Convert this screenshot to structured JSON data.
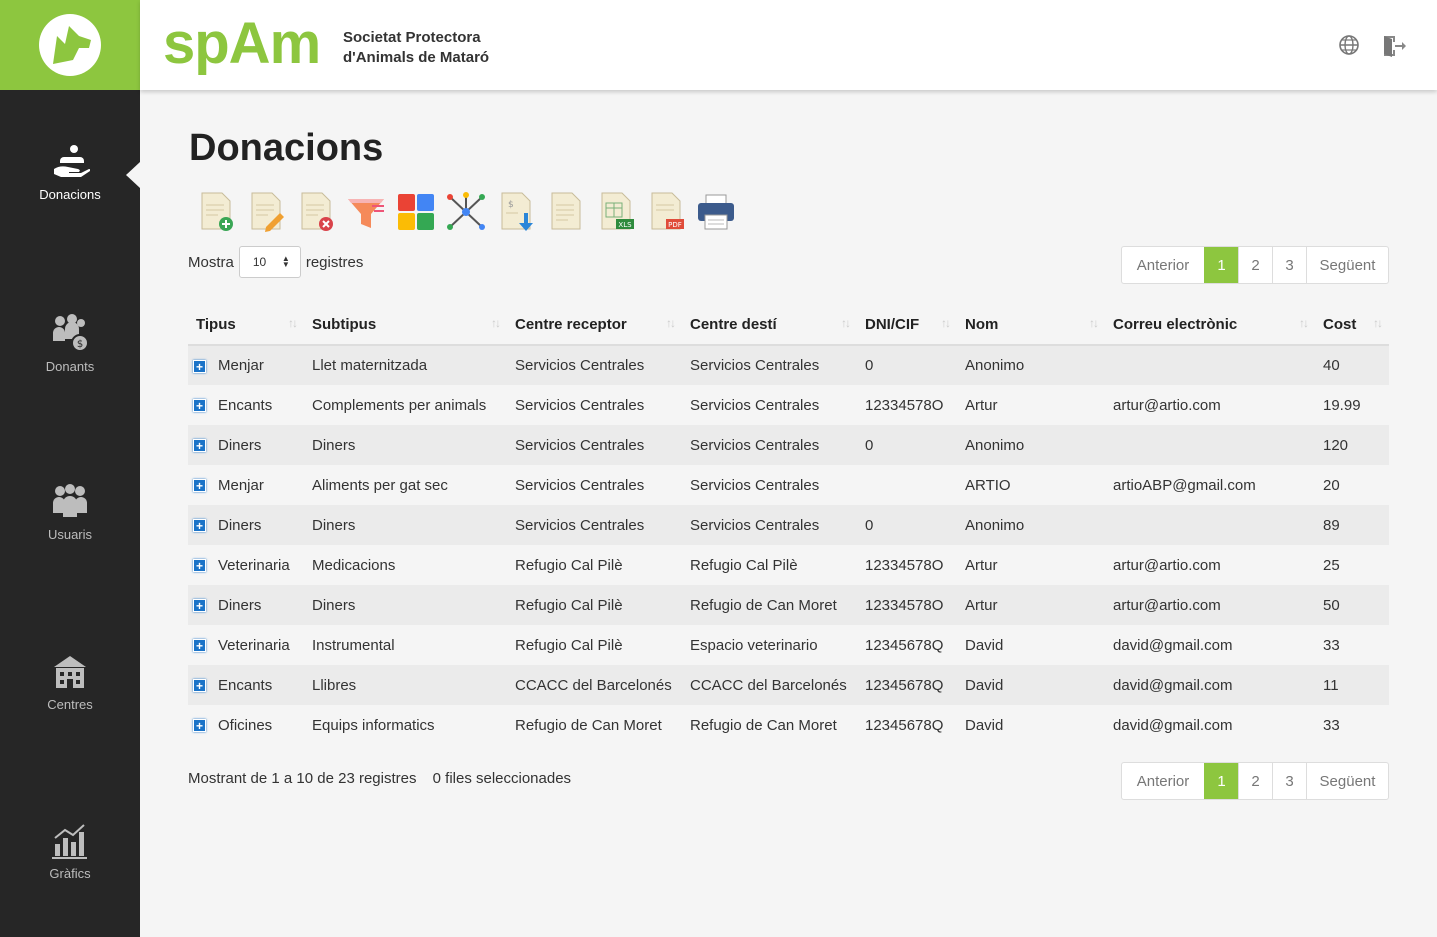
{
  "brand": {
    "name": "spAm",
    "sub1": "Societat Protectora",
    "sub2": "d'Animals de Mataró"
  },
  "sidebar": {
    "items": [
      {
        "label": "Donacions",
        "icon": "donation-hand-icon",
        "active": true
      },
      {
        "label": "Donants",
        "icon": "donors-icon"
      },
      {
        "label": "Usuaris",
        "icon": "users-icon"
      },
      {
        "label": "Centres",
        "icon": "building-icon"
      },
      {
        "label": "Gràfics",
        "icon": "bar-chart-icon"
      }
    ]
  },
  "header": {
    "icons": [
      "globe-icon",
      "logout-icon"
    ]
  },
  "page": {
    "title": "Donacions"
  },
  "toolbar": {
    "buttons": [
      "add-document-icon",
      "edit-document-icon",
      "delete-document-icon",
      "filter-icon",
      "color-grid-icon",
      "network-icon",
      "import-document-icon",
      "document-icon",
      "xls-export-icon",
      "pdf-export-icon",
      "print-icon"
    ]
  },
  "length": {
    "prefix": "Mostra",
    "value": "10",
    "suffix": "registres"
  },
  "pager": {
    "prev": "Anterior",
    "pages": [
      "1",
      "2",
      "3"
    ],
    "next": "Següent",
    "active": "1",
    "accent": "#8dc63f"
  },
  "table": {
    "columns": [
      "Tipus",
      "Subtipus",
      "Centre receptor",
      "Centre destí",
      "DNI/CIF",
      "Nom",
      "Correu electrònic",
      "Cost"
    ],
    "rows": [
      [
        "Menjar",
        "Llet maternitzada",
        "Servicios Centrales",
        "Servicios Centrales",
        "0",
        "Anonimo",
        "",
        "40"
      ],
      [
        "Encants",
        "Complements per animals",
        "Servicios Centrales",
        "Servicios Centrales",
        "12334578O",
        "Artur",
        "artur@artio.com",
        "19.99"
      ],
      [
        "Diners",
        "Diners",
        "Servicios Centrales",
        "Servicios Centrales",
        "0",
        "Anonimo",
        "",
        "120"
      ],
      [
        "Menjar",
        "Aliments per gat sec",
        "Servicios Centrales",
        "Servicios Centrales",
        "",
        "ARTIO",
        "artioABP@gmail.com",
        "20"
      ],
      [
        "Diners",
        "Diners",
        "Servicios Centrales",
        "Servicios Centrales",
        "0",
        "Anonimo",
        "",
        "89"
      ],
      [
        "Veterinaria",
        "Medicacions",
        "Refugio Cal Pilè",
        "Refugio Cal Pilè",
        "12334578O",
        "Artur",
        "artur@artio.com",
        "25"
      ],
      [
        "Diners",
        "Diners",
        "Refugio Cal Pilè",
        "Refugio de Can Moret",
        "12334578O",
        "Artur",
        "artur@artio.com",
        "50"
      ],
      [
        "Veterinaria",
        "Instrumental",
        "Refugio Cal Pilè",
        "Espacio veterinario",
        "12345678Q",
        "David",
        "david@gmail.com",
        "33"
      ],
      [
        "Encants",
        "Llibres",
        "CCACC del Barcelonés",
        "CCACC del Barcelonés",
        "12345678Q",
        "David",
        "david@gmail.com",
        "11"
      ],
      [
        "Oficines",
        "Equips informatics",
        "Refugio de Can Moret",
        "Refugio de Can Moret",
        "12345678Q",
        "David",
        "david@gmail.com",
        "33"
      ]
    ]
  },
  "info": {
    "showing": "Mostrant de 1 a 10 de 23 registres",
    "selected": "0 files seleccionades"
  }
}
